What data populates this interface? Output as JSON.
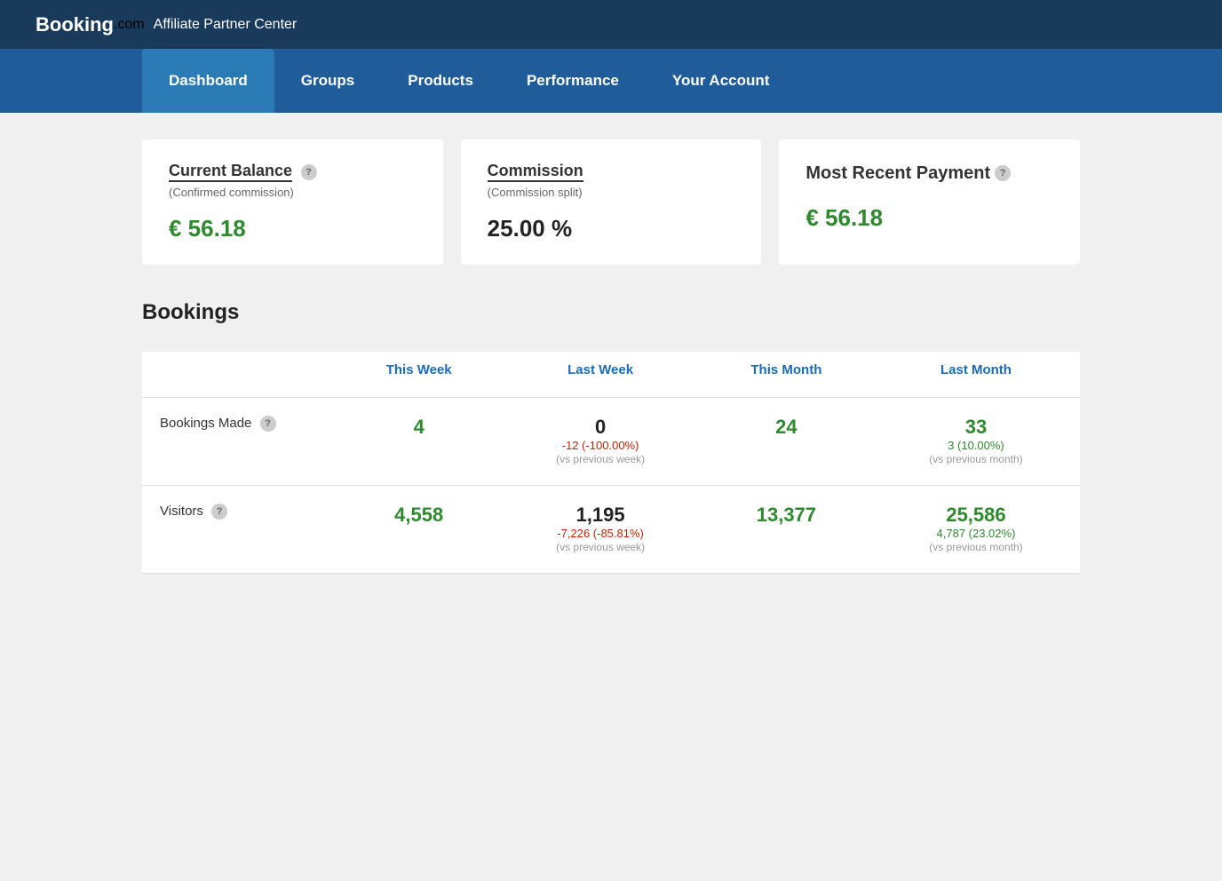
{
  "topbar": {
    "logo_booking": "Booking",
    "logo_dotcom": ".com",
    "logo_subtitle": "Affiliate Partner Center"
  },
  "nav": {
    "items": [
      {
        "label": "Dashboard",
        "active": true
      },
      {
        "label": "Groups",
        "active": false
      },
      {
        "label": "Products",
        "active": false
      },
      {
        "label": "Performance",
        "active": false
      },
      {
        "label": "Your Account",
        "active": false
      }
    ]
  },
  "cards": {
    "current_balance": {
      "title": "Current Balance",
      "subtitle": "(Confirmed commission)",
      "value": "€ 56.18"
    },
    "commission": {
      "title": "Commission",
      "subtitle": "(Commission split)",
      "value": "25.00 %"
    },
    "most_recent_payment": {
      "title": "Most Recent Payment",
      "value": "€ 56.18"
    }
  },
  "bookings": {
    "section_title": "Bookings",
    "columns": {
      "this_week": "This Week",
      "last_week": "Last Week",
      "this_month": "This Month",
      "last_month": "Last Month"
    },
    "rows": [
      {
        "label": "Bookings Made",
        "this_week": "4",
        "last_week": "0",
        "last_week_change": "-12 (-100.00%)",
        "last_week_note": "(vs previous week)",
        "this_month": "24",
        "last_month": "33",
        "last_month_change": "3 (10.00%)",
        "last_month_note": "(vs previous month)"
      },
      {
        "label": "Visitors",
        "this_week": "4,558",
        "last_week": "1,195",
        "last_week_change": "-7,226 (-85.81%)",
        "last_week_note": "(vs previous week)",
        "this_month": "13,377",
        "last_month": "25,586",
        "last_month_change": "4,787 (23.02%)",
        "last_month_note": "(vs previous month)"
      }
    ]
  }
}
